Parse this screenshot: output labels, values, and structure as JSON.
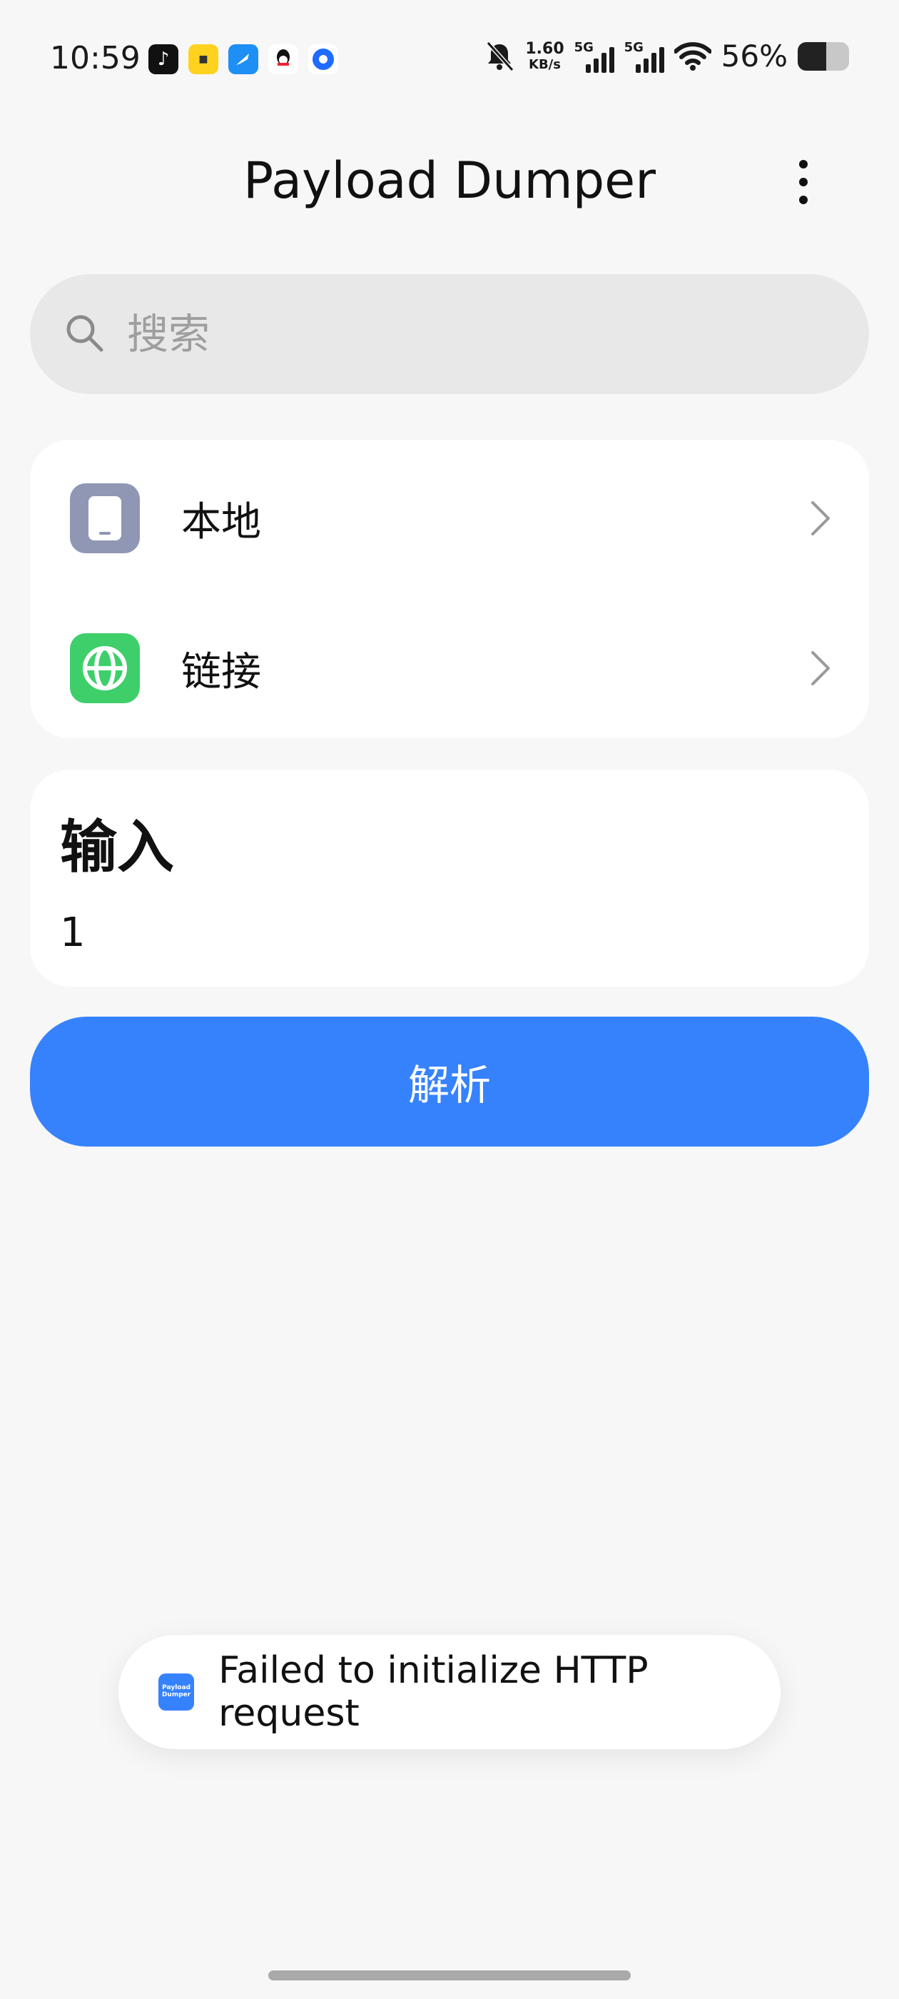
{
  "status_bar": {
    "time": "10:59",
    "net_speed_value": "1.60",
    "net_speed_unit": "KB/s",
    "sim1_label": "5G",
    "sim2_label": "5G",
    "battery_percent": "56%",
    "battery_level": 0.56,
    "notification_icons": [
      "tiktok-icon",
      "guoguo-icon",
      "feather-icon",
      "qq-icon",
      "blue-circle-icon"
    ]
  },
  "app": {
    "title": "Payload Dumper"
  },
  "search": {
    "placeholder": "搜索"
  },
  "sources": {
    "items": [
      {
        "label": "本地",
        "icon": "phone-icon"
      },
      {
        "label": "链接",
        "icon": "globe-icon"
      }
    ]
  },
  "input_section": {
    "title": "输入",
    "value": "1"
  },
  "actions": {
    "parse_label": "解析"
  },
  "toast": {
    "icon_line1": "Payload",
    "icon_line2": "Dumper",
    "message": "Failed to initialize HTTP request"
  },
  "colors": {
    "accent": "#3682fd",
    "background": "#f7f7f7",
    "local_icon_bg": "#8f97b5",
    "link_icon_bg": "#3ecf6a"
  }
}
